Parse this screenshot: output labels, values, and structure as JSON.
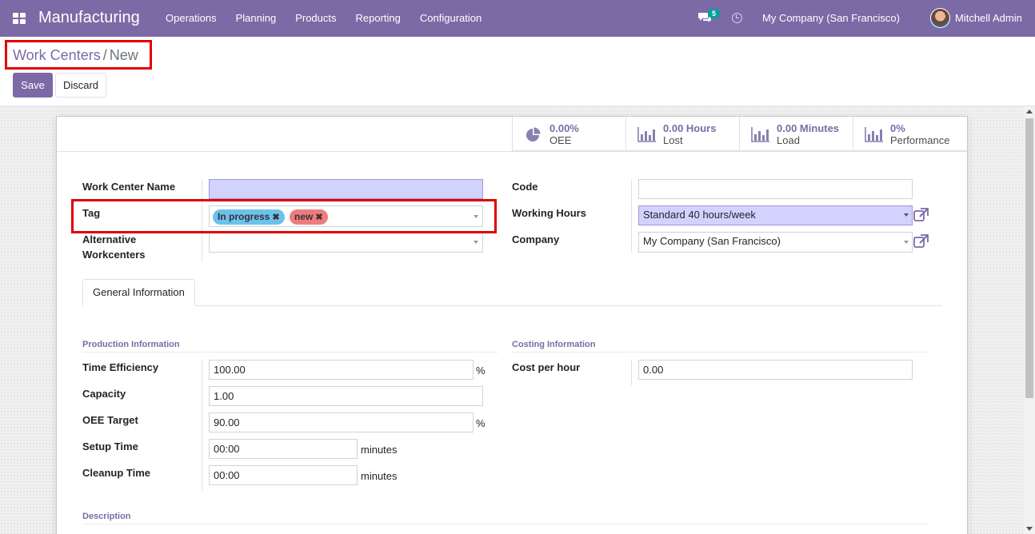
{
  "navbar": {
    "app_name": "Manufacturing",
    "menu": [
      "Operations",
      "Planning",
      "Products",
      "Reporting",
      "Configuration"
    ],
    "chat_count": "5",
    "company": "My Company (San Francisco)",
    "user": "Mitchell Admin"
  },
  "breadcrumb": {
    "parent": "Work Centers",
    "separator": "/",
    "current": "New"
  },
  "actions": {
    "save": "Save",
    "discard": "Discard"
  },
  "stats": [
    {
      "value": "0.00%",
      "label": "OEE",
      "icon": "pie-chart-icon"
    },
    {
      "value": "0.00 Hours",
      "label": "Lost",
      "icon": "bar-chart-icon"
    },
    {
      "value": "0.00 Minutes",
      "label": "Load",
      "icon": "bar-chart-icon"
    },
    {
      "value": "0%",
      "label": "Performance",
      "icon": "bar-chart-icon"
    }
  ],
  "form": {
    "work_center_name": {
      "label": "Work Center Name",
      "value": ""
    },
    "tag": {
      "label": "Tag",
      "tags": [
        "In progress",
        "new"
      ]
    },
    "alternative": {
      "label": "Alternative Workcenters",
      "value": ""
    },
    "code": {
      "label": "Code",
      "value": ""
    },
    "working_hours": {
      "label": "Working Hours",
      "value": "Standard 40 hours/week"
    },
    "company": {
      "label": "Company",
      "value": "My Company (San Francisco)"
    }
  },
  "tabs": [
    "General Information"
  ],
  "production": {
    "title": "Production Information",
    "time_efficiency": {
      "label": "Time Efficiency",
      "value": "100.00",
      "unit": "%"
    },
    "capacity": {
      "label": "Capacity",
      "value": "1.00"
    },
    "oee_target": {
      "label": "OEE Target",
      "value": "90.00",
      "unit": "%"
    },
    "setup_time": {
      "label": "Setup Time",
      "value": "00:00",
      "unit": "minutes"
    },
    "cleanup_time": {
      "label": "Cleanup Time",
      "value": "00:00",
      "unit": "minutes"
    }
  },
  "costing": {
    "title": "Costing Information",
    "cost_per_hour": {
      "label": "Cost per hour",
      "value": "0.00"
    }
  },
  "description": {
    "title": "Description"
  },
  "colors": {
    "brand": "#7c6aa6",
    "highlight": "#e00000",
    "tag_in_progress": "#6cc1ed",
    "tag_new": "#ee7c7c"
  }
}
